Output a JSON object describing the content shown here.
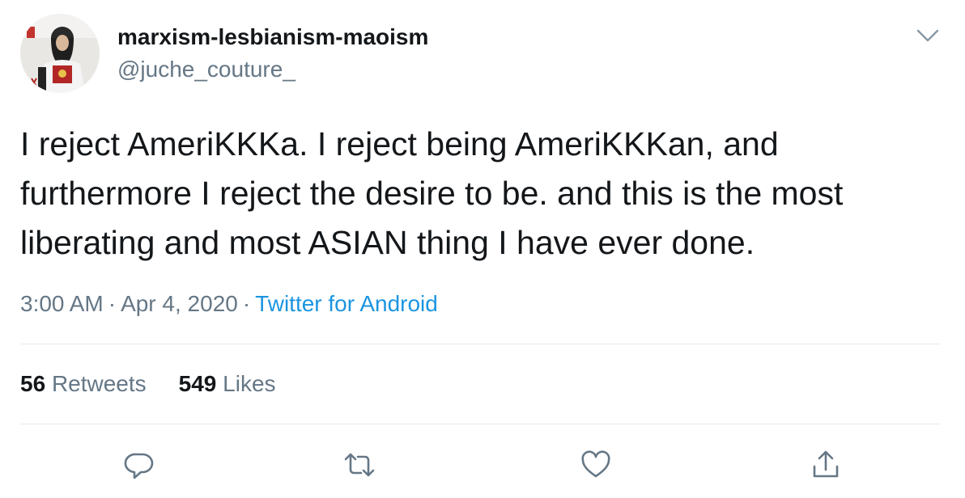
{
  "user": {
    "display_name": "marxism-lesbianism-maoism",
    "handle": "@juche_couture_",
    "avatar_icon": "profile-photo"
  },
  "tweet": {
    "text": "I reject AmeriKKKa. I reject being AmeriKKKan, and\nfurthermore I reject the desire to be. and this is the most\nliberating and most ASIAN thing I have ever done."
  },
  "meta": {
    "time": "3:00 AM",
    "separator": "·",
    "date": "Apr 4, 2020",
    "source": "Twitter for Android"
  },
  "stats": {
    "retweets_count": "56",
    "retweets_label": "Retweets",
    "likes_count": "549",
    "likes_label": "Likes"
  },
  "actions": {
    "icons": [
      "reply-icon",
      "retweet-icon",
      "like-icon",
      "share-icon"
    ]
  },
  "colors": {
    "text": "#14171a",
    "secondary": "#657786",
    "link": "#1b95e0",
    "divider": "#e6ecf0"
  }
}
